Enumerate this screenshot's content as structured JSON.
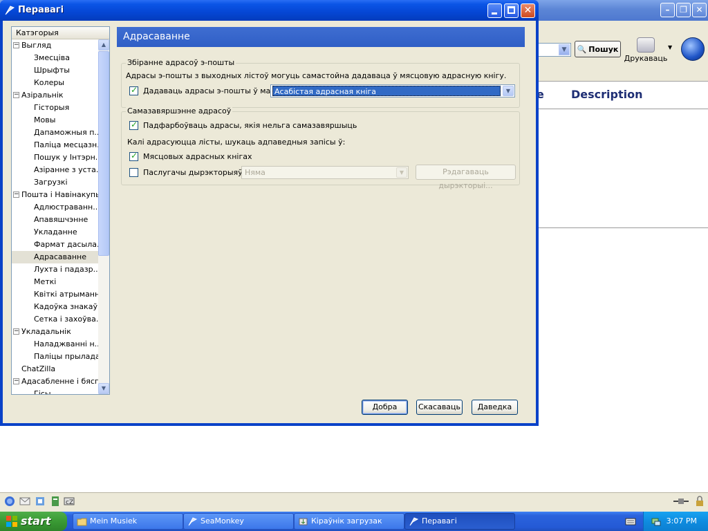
{
  "background_window": {
    "search_button": "Пошук",
    "print_label": "Друкаваць",
    "column_e": "e",
    "column_description": "Description"
  },
  "dialog": {
    "title": "Перавагі",
    "category_header": "Катэгорыя",
    "tree": [
      {
        "label": "Выгляд",
        "level": 0,
        "toggle": "−"
      },
      {
        "label": "Змесціва",
        "level": 1
      },
      {
        "label": "Шрыфты",
        "level": 1
      },
      {
        "label": "Колеры",
        "level": 1
      },
      {
        "label": "Азіральнік",
        "level": 0,
        "toggle": "−"
      },
      {
        "label": "Гісторыя",
        "level": 1
      },
      {
        "label": "Мовы",
        "level": 1
      },
      {
        "label": "Дапаможныя п...",
        "level": 1
      },
      {
        "label": "Паліца месцазн...",
        "level": 1
      },
      {
        "label": "Пошук у Інтэрн...",
        "level": 1
      },
      {
        "label": "Азіранне з уста...",
        "level": 1
      },
      {
        "label": "Загрузкі",
        "level": 1
      },
      {
        "label": "Пошта і Навінакупы",
        "level": 0,
        "toggle": "−"
      },
      {
        "label": "Адлюстраванн...",
        "level": 1
      },
      {
        "label": "Апавяшчэнне",
        "level": 1
      },
      {
        "label": "Укладанне",
        "level": 1
      },
      {
        "label": "Фармат дасыла...",
        "level": 1
      },
      {
        "label": "Адрасаванне",
        "level": 1,
        "selected": true
      },
      {
        "label": "Лухта і падазр...",
        "level": 1
      },
      {
        "label": "Меткі",
        "level": 1
      },
      {
        "label": "Квіткі атрымання",
        "level": 1
      },
      {
        "label": "Кадоўка знакаў",
        "level": 1
      },
      {
        "label": "Сетка і захоўва...",
        "level": 1
      },
      {
        "label": "Укладальнік",
        "level": 0,
        "toggle": "−"
      },
      {
        "label": "Наладжванні н...",
        "level": 1
      },
      {
        "label": "Паліцы прыладаў",
        "level": 1
      },
      {
        "label": "ChatZilla",
        "level": 0
      },
      {
        "label": "Адасабленне і бяспе...",
        "level": 0,
        "toggle": "−"
      },
      {
        "label": "Гісы",
        "level": 1
      }
    ],
    "panel_title": "Адрасаванне",
    "collect_group": {
      "legend": "Збіранне адрасоў э-пошты",
      "description": "Адрасы э-пошты з выходных лістоў могуць самастойна дадаваца ў мясцовую адрасную кнігу.",
      "add_checkbox_label": "Дадаваць адрасы э-пошты ў маю:",
      "add_checked": true,
      "addressbook_value": "Асабістая адрасная кніга"
    },
    "autocomplete_group": {
      "legend": "Самазавяршэнне адрасоў",
      "highlight_label": "Падфарбоўваць адрасы, якія нельга самазавяршыць",
      "highlight_checked": true,
      "search_intro": "Калі адрасуюцца лісты, шукаць адпаведныя запісы ў:",
      "local_label": "Мясцовых адрасных кнігах",
      "local_checked": true,
      "directory_label": "Паслугачы дырэкторыяў:",
      "directory_checked": false,
      "directory_value": "Няма",
      "edit_directories": "Рэдагаваць дырэкторыі..."
    },
    "buttons": {
      "ok": "Добра",
      "cancel": "Скасаваць",
      "help": "Даведка"
    }
  },
  "taskbar": {
    "start": "start",
    "tasks": [
      "Mein Musiek",
      "SeaMonkey",
      "Кіраўнік загрузак",
      "Перавагі"
    ],
    "active_task": "Перавагі",
    "clock": "3:07 PM"
  }
}
